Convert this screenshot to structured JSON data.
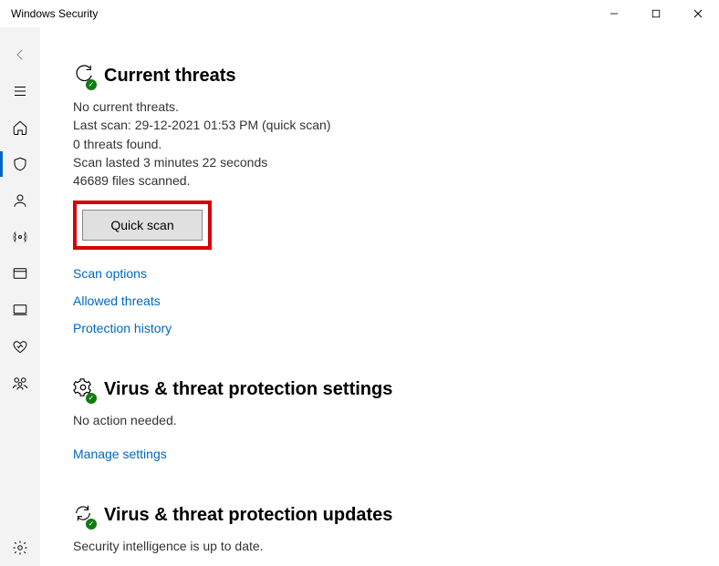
{
  "window": {
    "title": "Windows Security"
  },
  "sections": {
    "threats": {
      "title": "Current threats",
      "status": "No current threats.",
      "last_scan": "Last scan: 29-12-2021 01:53 PM (quick scan)",
      "found": "0 threats found.",
      "duration": "Scan lasted 3 minutes 22 seconds",
      "files": "46689 files scanned.",
      "button": "Quick scan",
      "links": {
        "options": "Scan options",
        "allowed": "Allowed threats",
        "history": "Protection history"
      }
    },
    "settings": {
      "title": "Virus & threat protection settings",
      "status": "No action needed.",
      "link": "Manage settings"
    },
    "updates": {
      "title": "Virus & threat protection updates",
      "status": "Security intelligence is up to date."
    }
  }
}
